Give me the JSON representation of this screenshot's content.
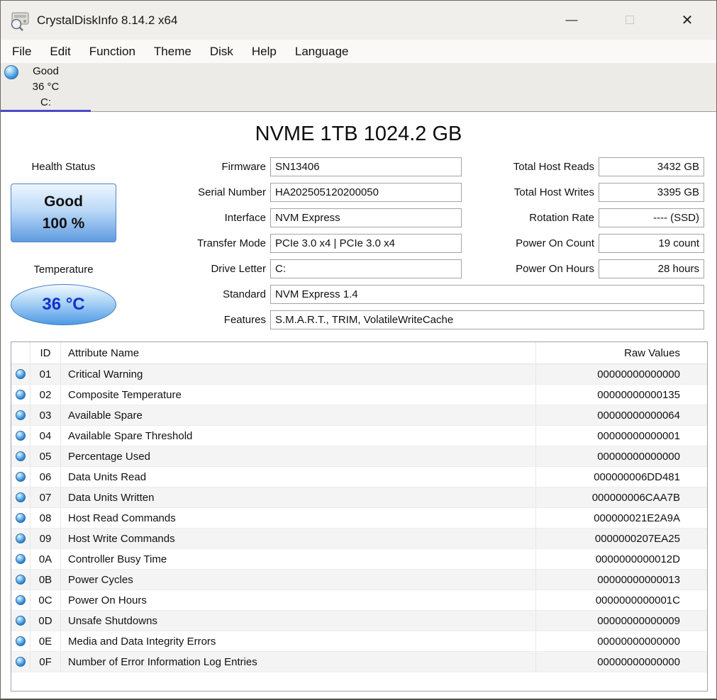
{
  "titlebar": {
    "title": "CrystalDiskInfo 8.14.2 x64",
    "minimize_glyph": "—",
    "close_glyph": "✕"
  },
  "menu": {
    "items": [
      {
        "label": "File"
      },
      {
        "label": "Edit"
      },
      {
        "label": "Function"
      },
      {
        "label": "Theme"
      },
      {
        "label": "Disk"
      },
      {
        "label": "Help"
      },
      {
        "label": "Language"
      }
    ]
  },
  "disk_tab": {
    "status": "Good",
    "temperature": "36 °C",
    "letter": "C:"
  },
  "drive": {
    "title": "NVME 1TB 1024.2 GB",
    "health": {
      "label": "Health Status",
      "status": "Good",
      "percent": "100 %"
    },
    "temperature": {
      "label": "Temperature",
      "value": "36 °C"
    }
  },
  "fields_mid": [
    {
      "label": "Firmware",
      "value": "SN13406"
    },
    {
      "label": "Serial Number",
      "value": "HA202505120200050"
    },
    {
      "label": "Interface",
      "value": "NVM Express"
    },
    {
      "label": "Transfer Mode",
      "value": "PCIe 3.0 x4 | PCIe 3.0 x4"
    },
    {
      "label": "Drive Letter",
      "value": "C:"
    },
    {
      "label": "Standard",
      "value": "NVM Express 1.4"
    },
    {
      "label": "Features",
      "value": "S.M.A.R.T., TRIM, VolatileWriteCache"
    }
  ],
  "fields_right": [
    {
      "label": "Total Host Reads",
      "value": "3432 GB"
    },
    {
      "label": "Total Host Writes",
      "value": "3395 GB"
    },
    {
      "label": "Rotation Rate",
      "value": "---- (SSD)"
    },
    {
      "label": "Power On Count",
      "value": "19 count"
    },
    {
      "label": "Power On Hours",
      "value": "28 hours"
    }
  ],
  "smart_table": {
    "headers": {
      "id": "ID",
      "name": "Attribute Name",
      "raw": "Raw Values"
    },
    "rows": [
      {
        "id": "01",
        "name": "Critical Warning",
        "raw": "00000000000000"
      },
      {
        "id": "02",
        "name": "Composite Temperature",
        "raw": "00000000000135"
      },
      {
        "id": "03",
        "name": "Available Spare",
        "raw": "00000000000064"
      },
      {
        "id": "04",
        "name": "Available Spare Threshold",
        "raw": "00000000000001"
      },
      {
        "id": "05",
        "name": "Percentage Used",
        "raw": "00000000000000"
      },
      {
        "id": "06",
        "name": "Data Units Read",
        "raw": "000000006DD481"
      },
      {
        "id": "07",
        "name": "Data Units Written",
        "raw": "000000006CAA7B"
      },
      {
        "id": "08",
        "name": "Host Read Commands",
        "raw": "000000021E2A9A"
      },
      {
        "id": "09",
        "name": "Host Write Commands",
        "raw": "0000000207EA25"
      },
      {
        "id": "0A",
        "name": "Controller Busy Time",
        "raw": "0000000000012D"
      },
      {
        "id": "0B",
        "name": "Power Cycles",
        "raw": "00000000000013"
      },
      {
        "id": "0C",
        "name": "Power On Hours",
        "raw": "0000000000001C"
      },
      {
        "id": "0D",
        "name": "Unsafe Shutdowns",
        "raw": "00000000000009"
      },
      {
        "id": "0E",
        "name": "Media and Data Integrity Errors",
        "raw": "00000000000000"
      },
      {
        "id": "0F",
        "name": "Number of Error Information Log Entries",
        "raw": "00000000000000"
      }
    ]
  },
  "colors": {
    "health_good_top": "#edf6ff",
    "health_good_bottom": "#5f9be0",
    "temperature_text": "#1133cc",
    "status_orb_blue": "#2f87d6",
    "selected_tab_underline": "#4a4ac8"
  }
}
